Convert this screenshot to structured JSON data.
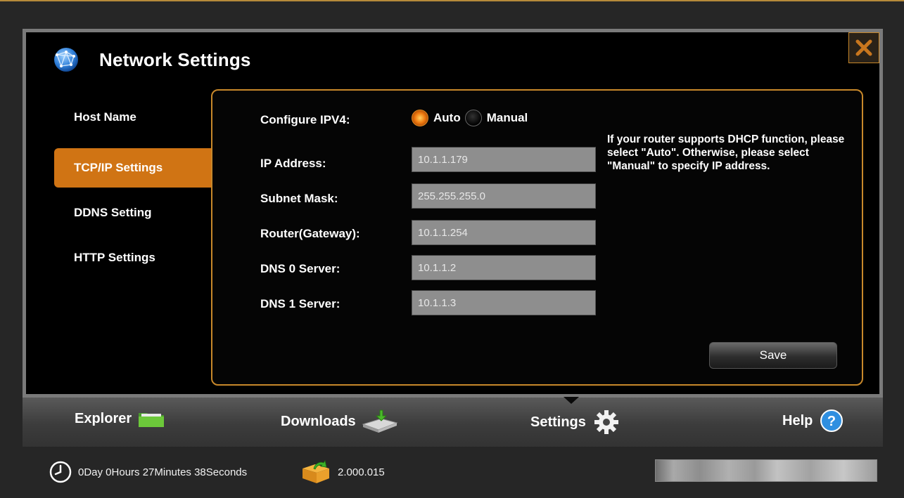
{
  "window": {
    "title": "Network Settings",
    "close_icon": "close-x-icon"
  },
  "nav": {
    "items": [
      {
        "label": "Host Name"
      },
      {
        "label": "TCP/IP Settings",
        "active": true
      },
      {
        "label": "DDNS Setting"
      },
      {
        "label": "HTTP Settings"
      }
    ]
  },
  "form": {
    "configure_label": "Configure IPV4:",
    "mode_options": [
      {
        "label": "Auto",
        "selected": true
      },
      {
        "label": "Manual",
        "selected": false
      }
    ],
    "fields": [
      {
        "label": "IP Address:",
        "value": "10.1.1.179"
      },
      {
        "label": "Subnet Mask:",
        "value": "255.255.255.0"
      },
      {
        "label": "Router(Gateway):",
        "value": "10.1.1.254"
      },
      {
        "label": "DNS 0 Server:",
        "value": "10.1.1.2"
      },
      {
        "label": "DNS 1 Server:",
        "value": "10.1.1.3"
      }
    ],
    "help_text": "If your router supports DHCP function, please select \"Auto\". Otherwise, please select \"Manual\" to specify IP address.",
    "save_label": "Save"
  },
  "tabs": [
    {
      "label": "Explorer",
      "icon": "folder-icon"
    },
    {
      "label": "Downloads",
      "icon": "download-drive-icon"
    },
    {
      "label": "Settings",
      "icon": "gear-icon",
      "active": true
    },
    {
      "label": "Help",
      "icon": "help-icon"
    }
  ],
  "status": {
    "uptime": "0Day 0Hours 27Minutes 38Seconds",
    "version": "2.000.015"
  },
  "colors": {
    "accent": "#d07414",
    "border_accent": "#c8882a",
    "background": "#262626"
  }
}
